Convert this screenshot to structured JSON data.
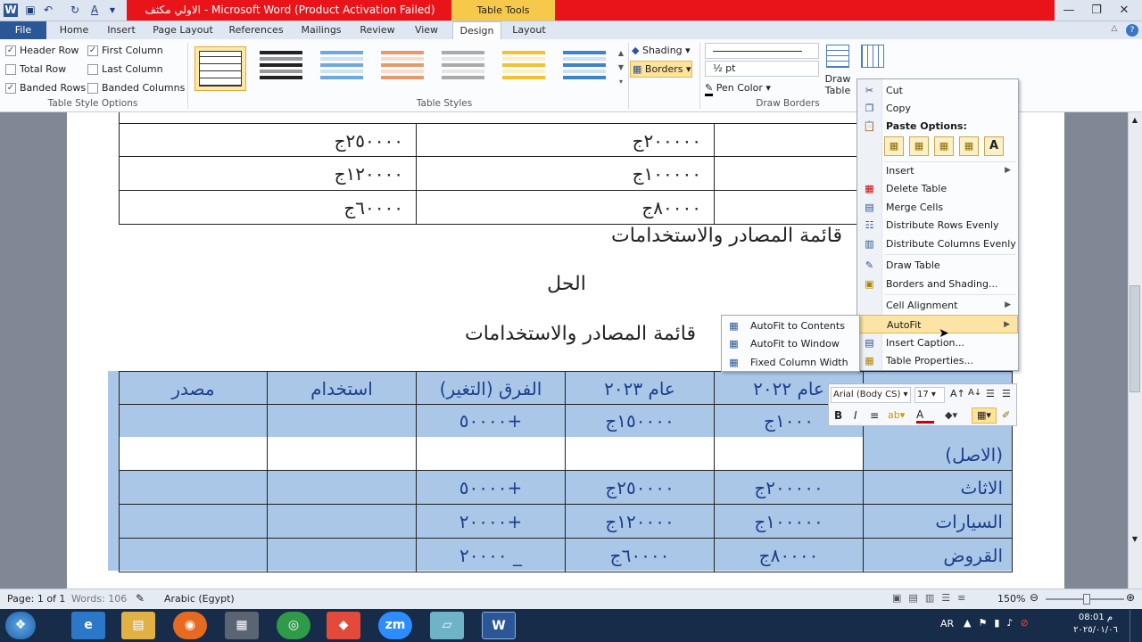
{
  "window": {
    "title": "الاولي مكثف  -  Microsoft Word (Product Activation Failed)",
    "context_tab_group": "Table Tools"
  },
  "tabs": [
    "File",
    "Home",
    "Insert",
    "Page Layout",
    "References",
    "Mailings",
    "Review",
    "View",
    "Design",
    "Layout"
  ],
  "ribbon": {
    "options": {
      "header_row": "Header Row",
      "first_column": "First Column",
      "total_row": "Total Row",
      "last_column": "Last Column",
      "banded_rows": "Banded Rows",
      "banded_columns": "Banded Columns",
      "group_label": "Table Style Options"
    },
    "styles_label": "Table Styles",
    "shading": "Shading",
    "borders": "Borders",
    "pen_weight": "½ pt",
    "pen_color": "Pen Color",
    "draw_table": "Draw Table",
    "draw_table_line1": "Draw",
    "draw_table_line2": "Table",
    "eraser": "Eraser",
    "draw_borders_label": "Draw Borders"
  },
  "document": {
    "top_table_rows": [
      [
        "٢٥٠٠٠٠ج",
        "٢٠٠٠٠٠ج",
        ""
      ],
      [
        "١٢٠٠٠٠ج",
        "١٠٠٠٠٠ج",
        ""
      ],
      [
        "٦٠٠٠٠ج",
        "٨٠٠٠٠ج",
        ""
      ]
    ],
    "heading1": "قائمة المصادر والاستخدامات",
    "heading_solution": "الحل",
    "heading2": "قائمة المصادر والاستخدامات",
    "table_headers": [
      "مصدر",
      "استخدام",
      "الفرق (التغير)",
      "عام ٢٠٢٣",
      "عام ٢٠٢٢",
      ""
    ],
    "table_rows": [
      {
        "c1": "",
        "c2": "",
        "c3": "+٥٠٠٠٠",
        "c4": "١٥٠٠٠٠ج",
        "c5": "١٠٠٠ج",
        "c6": "",
        "c6b": "(الاصل)"
      },
      {
        "c1": "",
        "c2": "",
        "c3": "+٥٠٠٠٠",
        "c4": "٢٥٠٠٠٠ج",
        "c5": "٢٠٠٠٠٠ج",
        "c6": "الاثاث"
      },
      {
        "c1": "",
        "c2": "",
        "c3": "+٢٠٠٠٠",
        "c4": "١٢٠٠٠٠ج",
        "c5": "١٠٠٠٠٠ج",
        "c6": "السيارات"
      },
      {
        "c1": "",
        "c2": "",
        "c3": "_ ٢٠٠٠٠",
        "c4": "٦٠٠٠٠ج",
        "c5": "٨٠٠٠٠ج",
        "c6": "القروض"
      }
    ]
  },
  "context_menu": {
    "cut": "Cut",
    "copy": "Copy",
    "paste_options": "Paste Options:",
    "insert": "Insert",
    "delete_table": "Delete Table",
    "merge_cells": "Merge Cells",
    "distribute_rows": "Distribute Rows Evenly",
    "distribute_columns": "Distribute Columns Evenly",
    "draw_table": "Draw Table",
    "borders_shading": "Borders and Shading...",
    "cell_alignment": "Cell Alignment",
    "autofit": "AutoFit",
    "insert_caption": "Insert Caption...",
    "table_properties": "Table Properties..."
  },
  "autofit_submenu": {
    "contents": "AutoFit to Contents",
    "window": "AutoFit to Window",
    "fixed": "Fixed Column Width"
  },
  "mini_toolbar": {
    "font": "Arial (Body CS)",
    "size": "17"
  },
  "status": {
    "page": "Page: 1 of 1",
    "words": "Words: 106",
    "language": "Arabic (Egypt)",
    "zoom": "150%"
  },
  "taskbar": {
    "lang": "AR",
    "time": "08:01 م",
    "date": "٢٠٢٥/٠١/٠٦"
  },
  "colors": {
    "title_red": "#e8141a",
    "selection": "#aac7e8",
    "file_tab": "#2b5797",
    "highlight": "#fbe4a6"
  }
}
